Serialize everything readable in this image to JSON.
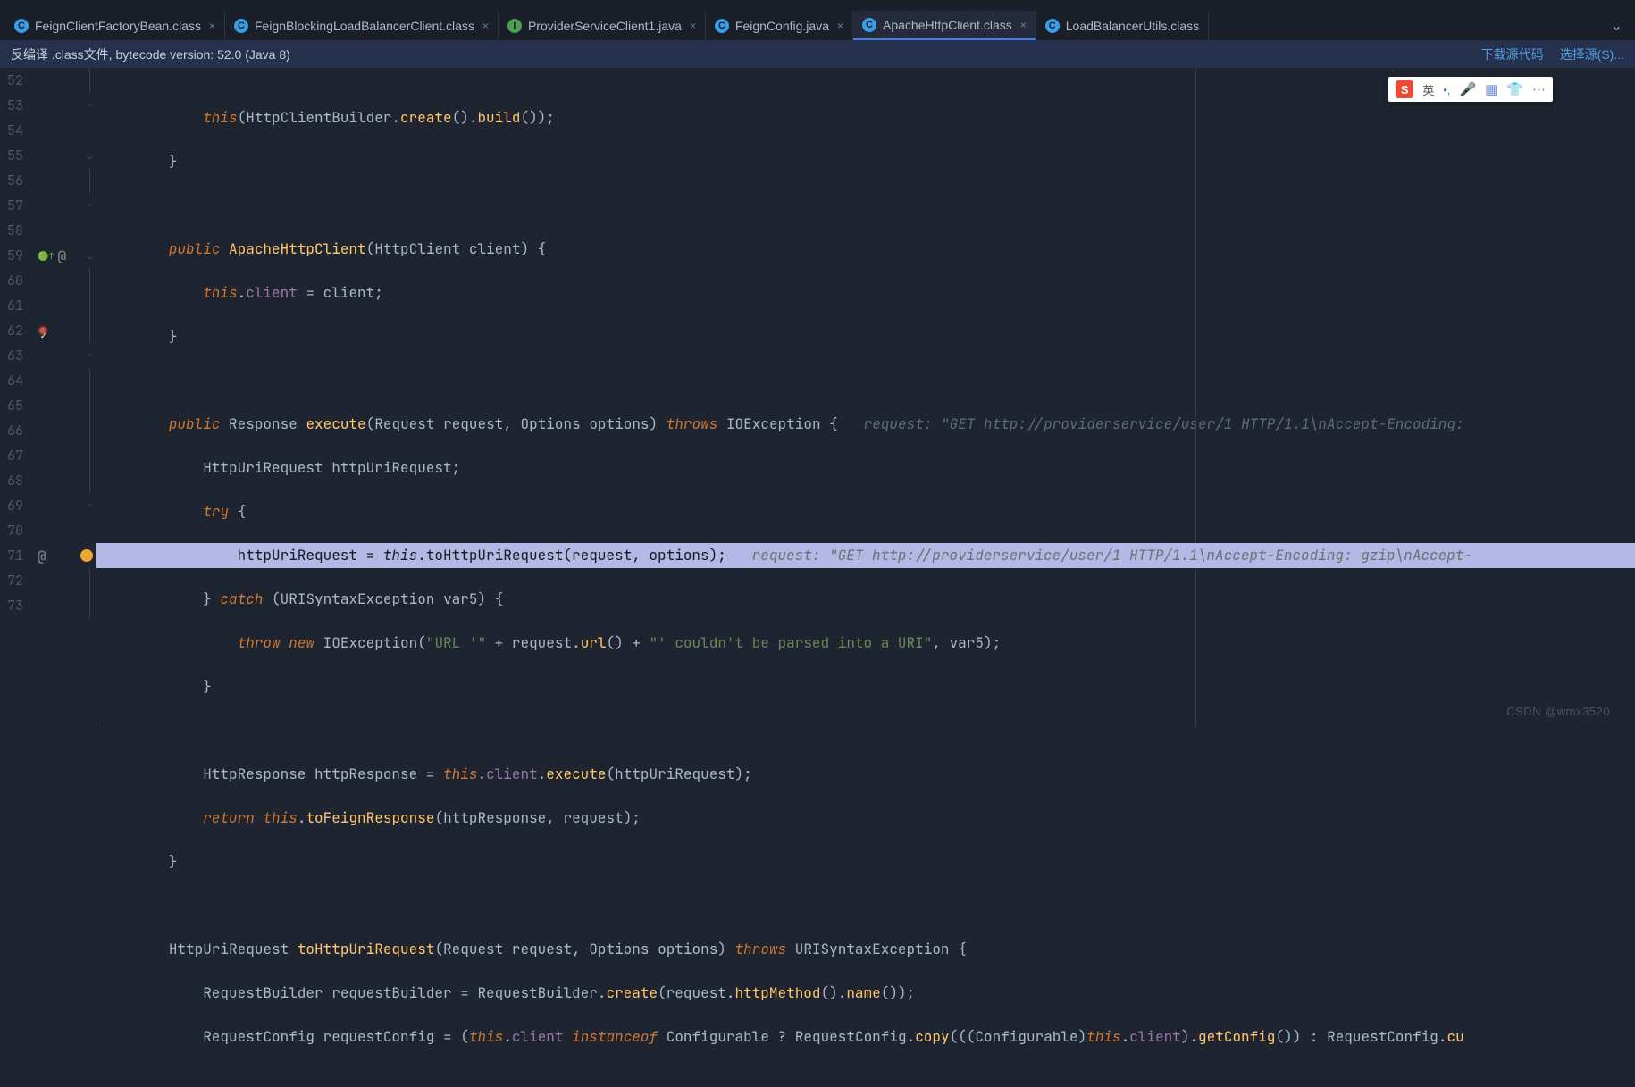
{
  "tabs": [
    {
      "label": "FeignClientFactoryBean.class",
      "icon": "c-blue",
      "active": false
    },
    {
      "label": "FeignBlockingLoadBalancerClient.class",
      "icon": "c-blue",
      "active": false
    },
    {
      "label": "ProviderServiceClient1.java",
      "icon": "c-green",
      "active": false
    },
    {
      "label": "FeignConfig.java",
      "icon": "c-blue",
      "active": false
    },
    {
      "label": "ApacheHttpClient.class",
      "icon": "c-blue",
      "active": true
    },
    {
      "label": "LoadBalancerUtils.class",
      "icon": "c-blue",
      "active": false
    }
  ],
  "banner": {
    "text": "反编译 .class文件, bytecode version: 52.0 (Java 8)",
    "link1": "下载源代码",
    "link2": "选择源(S)..."
  },
  "gutter": {
    "start": 52,
    "end": 73,
    "breakpoint_line": 62,
    "override_marker_line": 59,
    "at_marker_lines": [
      59,
      71
    ]
  },
  "hints": {
    "l59": "request: \"GET http://providerservice/user/1 HTTP/1.1\\nAccept-Encoding:",
    "l62": "request: \"GET http://providerservice/user/1 HTTP/1.1\\nAccept-Encoding: gzip\\nAccept-"
  },
  "code": {
    "l52": "            this(HttpClientBuilder.create().build());",
    "l53": "        }",
    "l55_sig": "        public ApacheHttpClient(HttpClient client) {",
    "l56": "            this.client = client;",
    "l57": "        }",
    "l59_sig": "        public Response execute(Request request, Options options) throws IOException {",
    "l60": "            HttpUriRequest httpUriRequest;",
    "l61": "            try {",
    "l62": "                httpUriRequest = this.toHttpUriRequest(request, options);",
    "l63": "            } catch (URISyntaxException var5) {",
    "l64": "                throw new IOException(\"URL '\" + request.url() + \"' couldn't be parsed into a URI\", var5);",
    "l65": "            }",
    "l67": "            HttpResponse httpResponse = this.client.execute(httpUriRequest);",
    "l68": "            return this.toFeignResponse(httpResponse, request);",
    "l69": "        }",
    "l71_sig": "        HttpUriRequest toHttpUriRequest(Request request, Options options) throws URISyntaxException {",
    "l72": "            RequestBuilder requestBuilder = RequestBuilder.create(request.httpMethod().name());",
    "l73": "            RequestConfig requestConfig = (this.client instanceof Configurable ? RequestConfig.copy(((Configurable)this.client).getConfig()) : RequestConfig.cu"
  },
  "ime": {
    "logo": "S",
    "lang": "英",
    "dot": "•,",
    "mic": "🎤",
    "grid": "▦",
    "shirt": "👕",
    "more": "⋯"
  },
  "watermark": "CSDN @wmx3520"
}
